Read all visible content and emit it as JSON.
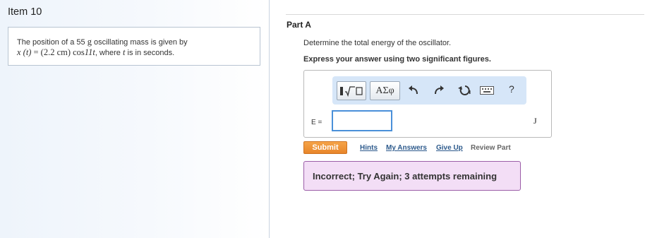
{
  "item": {
    "title": "Item 10",
    "problem": {
      "prefix": "The position of a 55",
      "mass_unit": "g",
      "mid": "oscillating mass is given by",
      "math_lhs": "x (t)",
      "math_eq": "=",
      "math_amp": "(2.2 cm)",
      "math_cos": "cos",
      "math_arg": "11t",
      "where": ", where",
      "t_var": "t",
      "suffix": "is in seconds."
    }
  },
  "part": {
    "title": "Part A",
    "question": "Determine the total energy of the oscillator.",
    "instruction": "Express your answer using two significant figures."
  },
  "toolbar": {
    "templates_icon": "templates-icon",
    "symbols_label": "ΑΣφ",
    "undo_icon": "undo-icon",
    "redo_icon": "redo-icon",
    "reset_icon": "reset-icon",
    "keyboard_icon": "keyboard-icon",
    "help_label": "?",
    "accent": "#d6e6f8"
  },
  "answer": {
    "variable_label": "E =",
    "value": "",
    "unit": "J"
  },
  "actions": {
    "submit_label": "Submit",
    "hints_label": "Hints",
    "my_answers_label": "My Answers",
    "give_up_label": "Give Up",
    "review_part_label": "Review Part",
    "submit_color": "#e8852a"
  },
  "feedback": {
    "text": "Incorrect; Try Again; 3 attempts remaining",
    "bg_color": "#f3def6",
    "border_color": "#9b5ea8"
  }
}
